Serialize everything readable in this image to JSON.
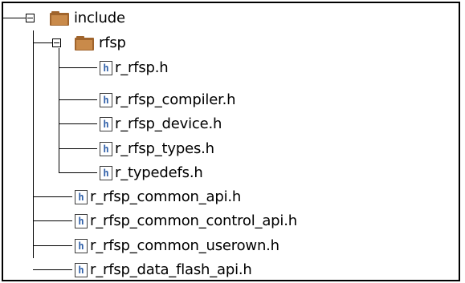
{
  "tree": {
    "include": {
      "label": "include",
      "icon": "folder-icon",
      "expanded": true
    },
    "rfsp": {
      "label": "rfsp",
      "icon": "folder-icon",
      "expanded": true
    },
    "files": [
      {
        "label": "r_rfsp.h",
        "icon": "header-file-icon",
        "glyph": "h"
      },
      {
        "label": "r_rfsp_compiler.h",
        "icon": "header-file-icon",
        "glyph": "h"
      },
      {
        "label": "r_rfsp_device.h",
        "icon": "header-file-icon",
        "glyph": "h"
      },
      {
        "label": "r_rfsp_types.h",
        "icon": "header-file-icon",
        "glyph": "h"
      },
      {
        "label": "r_typedefs.h",
        "icon": "header-file-icon",
        "glyph": "h"
      },
      {
        "label": "r_rfsp_common_api.h",
        "icon": "header-file-icon",
        "glyph": "h"
      },
      {
        "label": "r_rfsp_common_control_api.h",
        "icon": "header-file-icon",
        "glyph": "h"
      },
      {
        "label": "r_rfsp_common_userown.h",
        "icon": "header-file-icon",
        "glyph": "h"
      },
      {
        "label": "r_rfsp_data_flash_api.h",
        "icon": "header-file-icon",
        "glyph": "h"
      }
    ]
  },
  "colors": {
    "folder": "#a0642c",
    "folder_light": "#c98a4a",
    "line": "#000000",
    "file_glyph": "#2f5fa8"
  }
}
